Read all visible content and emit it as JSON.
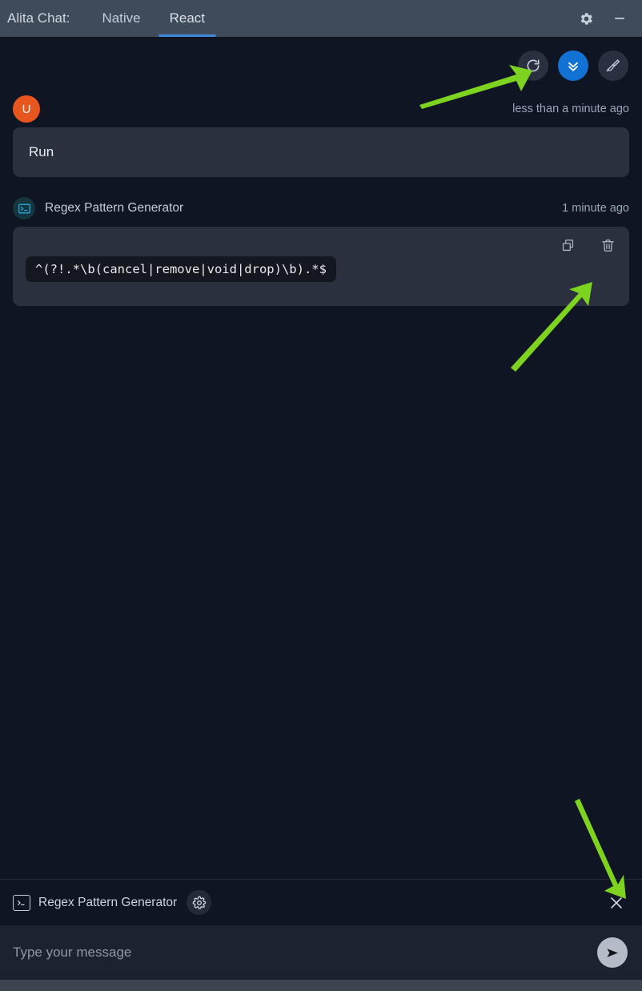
{
  "window": {
    "app_title": "Alita Chat:",
    "tabs": [
      {
        "label": "Native",
        "active": false
      },
      {
        "label": "React",
        "active": true
      }
    ],
    "controls": {
      "settings_icon": "gear-icon",
      "minimize_icon": "minimize-icon"
    },
    "accent_color": "#1272d4",
    "titlebar_color": "#3f4a5a"
  },
  "chat_actions": {
    "refresh_label": "refresh-icon",
    "scroll_bottom_label": "double-chevron-down-icon",
    "clear_label": "broom-icon"
  },
  "messages": [
    {
      "role": "user",
      "avatar_initial": "U",
      "avatar_color": "#e8561f",
      "timestamp": "less than a minute ago",
      "text": "Run"
    },
    {
      "role": "assistant",
      "icon": "terminal-icon",
      "name": "Regex Pattern Generator",
      "timestamp": "1 minute ago",
      "code": "^(?!.*\\b(cancel|remove|void|drop)\\b).*$",
      "tools": {
        "copy_label": "copy-icon",
        "delete_label": "trash-icon"
      }
    }
  ],
  "toolbar": {
    "tool_icon": "terminal-icon",
    "tool_name": "Regex Pattern Generator",
    "settings_icon": "gear-icon",
    "close_icon": "close-icon"
  },
  "composer": {
    "placeholder": "Type your message",
    "value": "",
    "send_icon": "send-icon"
  },
  "annotations": {
    "color": "#7ed321",
    "arrows": [
      {
        "name": "arrow-to-refresh-button",
        "points_to": "refresh-button"
      },
      {
        "name": "arrow-to-delete-button",
        "points_to": "delete-message-button"
      },
      {
        "name": "arrow-to-close-toolbar",
        "points_to": "close-toolbar-button"
      }
    ]
  }
}
